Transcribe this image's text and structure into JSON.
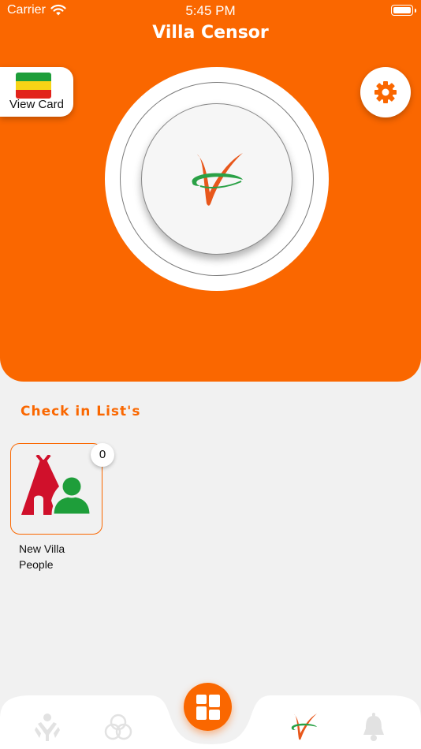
{
  "status_bar": {
    "carrier": "Carrier",
    "time": "5:45 PM"
  },
  "header": {
    "title": "Villa Censor",
    "view_card_label": "View Card"
  },
  "section": {
    "title": "Check in List's",
    "tiles": [
      {
        "label": "New Villa People",
        "count": "0"
      }
    ]
  },
  "colors": {
    "accent": "#fa6700",
    "background": "#f1f1f1",
    "icon_red": "#d0102b",
    "icon_green": "#1e9e3a"
  },
  "icons": {
    "settings": "gear-icon",
    "logo": "villa-v-logo-icon",
    "tile": "tent-person-icon",
    "nav": [
      "people-icon",
      "rings-icon",
      "dashboard-grid-icon",
      "villa-v-logo-icon",
      "bell-icon"
    ]
  }
}
